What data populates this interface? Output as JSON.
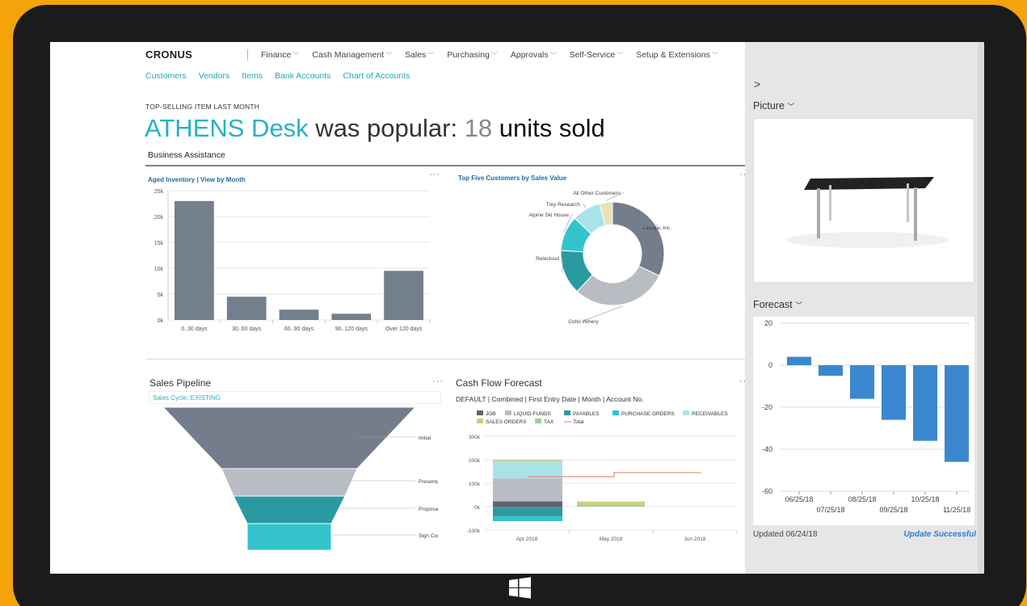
{
  "nav": {
    "brand": "CRONUS",
    "menu": [
      "Finance",
      "Cash Management",
      "Sales",
      "Purchasing",
      "Approvals",
      "Self-Service",
      "Setup & Extensions"
    ],
    "links": [
      "Customers",
      "Vendors",
      "Items",
      "Bank Accounts",
      "Chart of Accounts"
    ]
  },
  "headline": {
    "kicker": "TOP-SELLING ITEM LAST MONTH",
    "item": "ATHENS Desk",
    "middle": " was popular: ",
    "count": "18",
    "suffix": " units sold"
  },
  "tab": "Business Assistance",
  "aged_inventory": {
    "title": "Aged Inventory | View by Month",
    "chart_data": {
      "type": "bar",
      "categories": [
        "0..30 days",
        "30..60 days",
        "60..90 days",
        "90..120 days",
        "Over 120 days"
      ],
      "values": [
        23000,
        4500,
        2000,
        1200,
        9500
      ],
      "yticks": [
        "25k",
        "20k",
        "15k",
        "10k",
        "5k",
        "0k"
      ],
      "ylim": [
        0,
        25000
      ],
      "color": "#747f8d"
    }
  },
  "top_customers": {
    "title": "Top Five Customers by Sales Value",
    "chart_data": {
      "type": "pie",
      "labels": [
        "Litware, Inc.",
        "Coho Winery",
        "Relecloud",
        "Alpine Ski House",
        "Trey Research",
        "All Other Customers"
      ],
      "values": [
        32,
        30,
        14,
        11,
        9,
        4
      ],
      "colors": [
        "#737d8b",
        "#b9bcc3",
        "#2a9aa1",
        "#34c3cd",
        "#a9e3e8",
        "#e8e2b8"
      ]
    }
  },
  "sales_pipeline": {
    "title": "Sales Pipeline",
    "filter": "Sales Cycle: EXISTING",
    "stages": [
      "Initial",
      "Presentation",
      "Proposal",
      "Sign Contract"
    ],
    "colors": [
      "#737d8b",
      "#b9bcc3",
      "#2a9aa1",
      "#34c3cd"
    ]
  },
  "cash_flow": {
    "title": "Cash Flow Forecast",
    "subtitle": "DEFAULT | Combined | First Entry Date | Month | Account No.",
    "legend": [
      {
        "label": "JOB",
        "color": "#5c6470"
      },
      {
        "label": "LIQUID FUNDS",
        "color": "#b9bcc3"
      },
      {
        "label": "PAYABLES",
        "color": "#2a9aa1"
      },
      {
        "label": "PURCHASE ORDERS",
        "color": "#34c3cd"
      },
      {
        "label": "RECEIVABLES",
        "color": "#a9e3e8"
      },
      {
        "label": "SALES ORDERS",
        "color": "#d6cc7a"
      },
      {
        "label": "TAX",
        "color": "#9ad49a"
      },
      {
        "label": "Total",
        "color": "#ef8a80"
      }
    ],
    "yticks": [
      "300k",
      "200k",
      "100k",
      "0k",
      "-100k"
    ],
    "xticks": [
      "Apr 2018",
      "May 2018",
      "Jun 2018"
    ]
  },
  "pane": {
    "picture_label": "Picture",
    "forecast_label": "Forecast",
    "updated": "Updated 06/24/18",
    "status": "Update Successful",
    "forecast_chart": {
      "type": "bar",
      "categories": [
        "06/25/18",
        "07/25/18",
        "08/25/18",
        "09/25/18",
        "10/25/18",
        "11/25/18"
      ],
      "values": [
        4,
        -5,
        -16,
        -26,
        -36,
        -46
      ],
      "yticks": [
        "20",
        "0",
        "-20",
        "-40",
        "-60"
      ],
      "ylim": [
        -60,
        20
      ],
      "color": "#3b87cf"
    }
  }
}
